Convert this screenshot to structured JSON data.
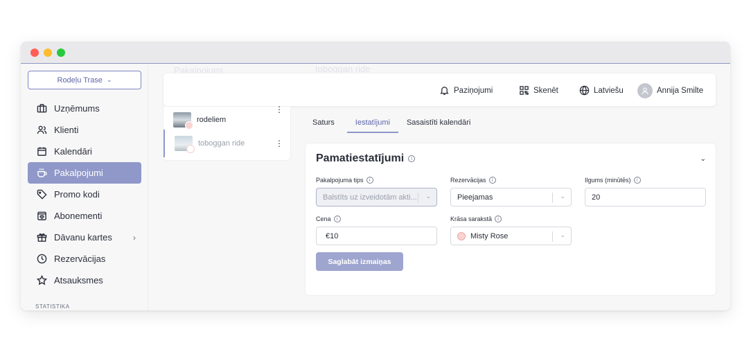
{
  "business": {
    "name": "Rodeļu Trase"
  },
  "sidebar": {
    "items": [
      {
        "label": "Uzņēmums",
        "icon": "briefcase-icon"
      },
      {
        "label": "Klienti",
        "icon": "users-icon"
      },
      {
        "label": "Kalendāri",
        "icon": "calendar-icon"
      },
      {
        "label": "Pakalpojumi",
        "icon": "cup-icon",
        "active": true
      },
      {
        "label": "Promo kodi",
        "icon": "tag-icon"
      },
      {
        "label": "Abonementi",
        "icon": "calendar-heart-icon"
      },
      {
        "label": "Dāvanu kartes",
        "icon": "gift-icon",
        "has_submenu": true
      },
      {
        "label": "Rezervācijas",
        "icon": "clock-icon"
      },
      {
        "label": "Atsauksmes",
        "icon": "star-icon"
      }
    ],
    "section_label": "STATISTIKA"
  },
  "ghost_text": {
    "services_header": "Pakalpojumi",
    "service_title": "toboggan ride"
  },
  "topbar": {
    "notifications": "Paziņojumi",
    "scan": "Skenēt",
    "language": "Latviešu",
    "user": "Annija Smilte"
  },
  "services": [
    {
      "name": "rodeliem"
    },
    {
      "name": "toboggan ride",
      "selected": true
    }
  ],
  "tabs": [
    {
      "label": "Saturs"
    },
    {
      "label": "Iestatījumi",
      "active": true
    },
    {
      "label": "Sasaistīti kalendāri"
    }
  ],
  "panel": {
    "title": "Pamatiestatījumi",
    "fields": {
      "service_type": {
        "label": "Pakalpojuma tips",
        "value": "Balstīts uz izveidotām akti..."
      },
      "reservations": {
        "label": "Rezervācijas",
        "value": "Pieejamas"
      },
      "duration": {
        "label": "Ilgums (minūtēs)",
        "value": "20"
      },
      "price": {
        "label": "Cena",
        "value": "€10"
      },
      "color": {
        "label": "Krāsa sarakstā",
        "value": "Misty Rose",
        "swatch": "#fbd3d0"
      }
    },
    "save_label": "Saglabāt izmaiņas"
  },
  "colors": {
    "accent": "#8f98c8",
    "accent_text": "#5d65a8"
  }
}
